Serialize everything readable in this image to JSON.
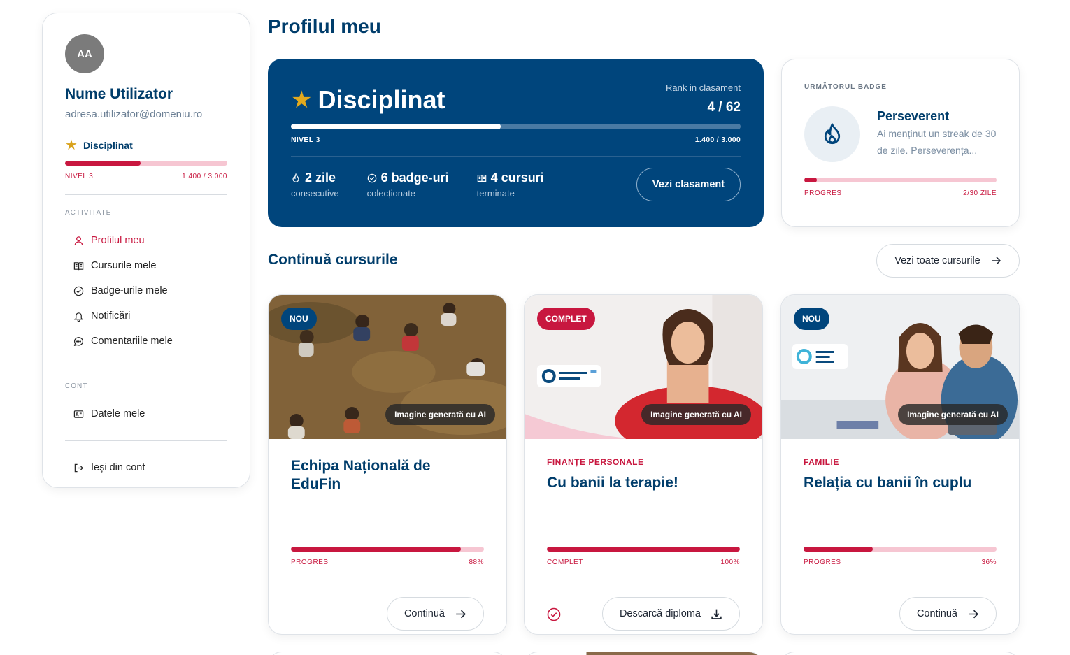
{
  "user": {
    "initials": "AA",
    "name": "Nume Utilizator",
    "email": "adresa.utilizator@domeniu.ro",
    "rank": "Disciplinat",
    "level": "NIVEL 3",
    "points": "1.400 / 3.000",
    "progress": 0.467
  },
  "sidebar": {
    "activity_label": "ACTIVITATE",
    "account_label": "CONT",
    "items": [
      {
        "label": "Profilul meu",
        "icon": "user-icon",
        "active": true
      },
      {
        "label": "Cursurile mele",
        "icon": "book-icon"
      },
      {
        "label": "Badge-urile mele",
        "icon": "badge-check-icon"
      },
      {
        "label": "Notificări",
        "icon": "bell-icon"
      },
      {
        "label": "Comentariile mele",
        "icon": "comment-icon"
      }
    ],
    "account_items": [
      {
        "label": "Datele mele",
        "icon": "id-card-icon"
      }
    ],
    "logout": {
      "label": "Ieși din cont",
      "icon": "logout-icon"
    }
  },
  "page": {
    "title": "Profilul meu"
  },
  "hero": {
    "title": "Disciplinat",
    "rank_label": "Rank in clasament",
    "rank_value": "4 / 62",
    "level": "NIVEL 3",
    "points": "1.400 / 3.000",
    "progress": 0.467,
    "stats": [
      {
        "value": "2 zile",
        "label": "consecutive",
        "icon": "flame-icon"
      },
      {
        "value": "6 badge-uri",
        "label": "colecționate",
        "icon": "badge-check-icon"
      },
      {
        "value": "4 cursuri",
        "label": "terminate",
        "icon": "book-icon"
      }
    ],
    "button": "Vezi clasament"
  },
  "next_badge": {
    "label": "URMĂTORUL BADGE",
    "title": "Perseverent",
    "description": "Ai menținut un streak de 30 de zile. Perseverența...",
    "progress_label": "PROGRES",
    "progress_value": "2/30 ZILE",
    "progress": 0.067,
    "icon": "flame-icon"
  },
  "courses_section": {
    "title": "Continuă cursurile",
    "all_button": "Vezi toate cursurile"
  },
  "courses": [
    {
      "tag": "NOU",
      "ai_label": "Imagine generată cu AI",
      "category": "",
      "title": "Echipa Națională de EduFin",
      "status_label": "PROGRES",
      "percent": "88%",
      "progress": 0.88,
      "button": "Continuă"
    },
    {
      "tag": "COMPLET",
      "ai_label": "Imagine generată cu AI",
      "category": "FINANȚE PERSONALE",
      "title": "Cu banii la terapie!",
      "status_label": "COMPLET",
      "percent": "100%",
      "progress": 1.0,
      "button": "Descarcă diploma"
    },
    {
      "tag": "NOU",
      "ai_label": "Imagine generată cu AI",
      "category": "FAMILIE",
      "title": "Relația cu banii în cuplu",
      "status_label": "PROGRES",
      "percent": "36%",
      "progress": 0.36,
      "button": "Continuă"
    }
  ],
  "colors": {
    "navy": "#00457c",
    "red": "#c8173f",
    "pink": "#f6c6d2",
    "gold": "#d9a21b"
  }
}
